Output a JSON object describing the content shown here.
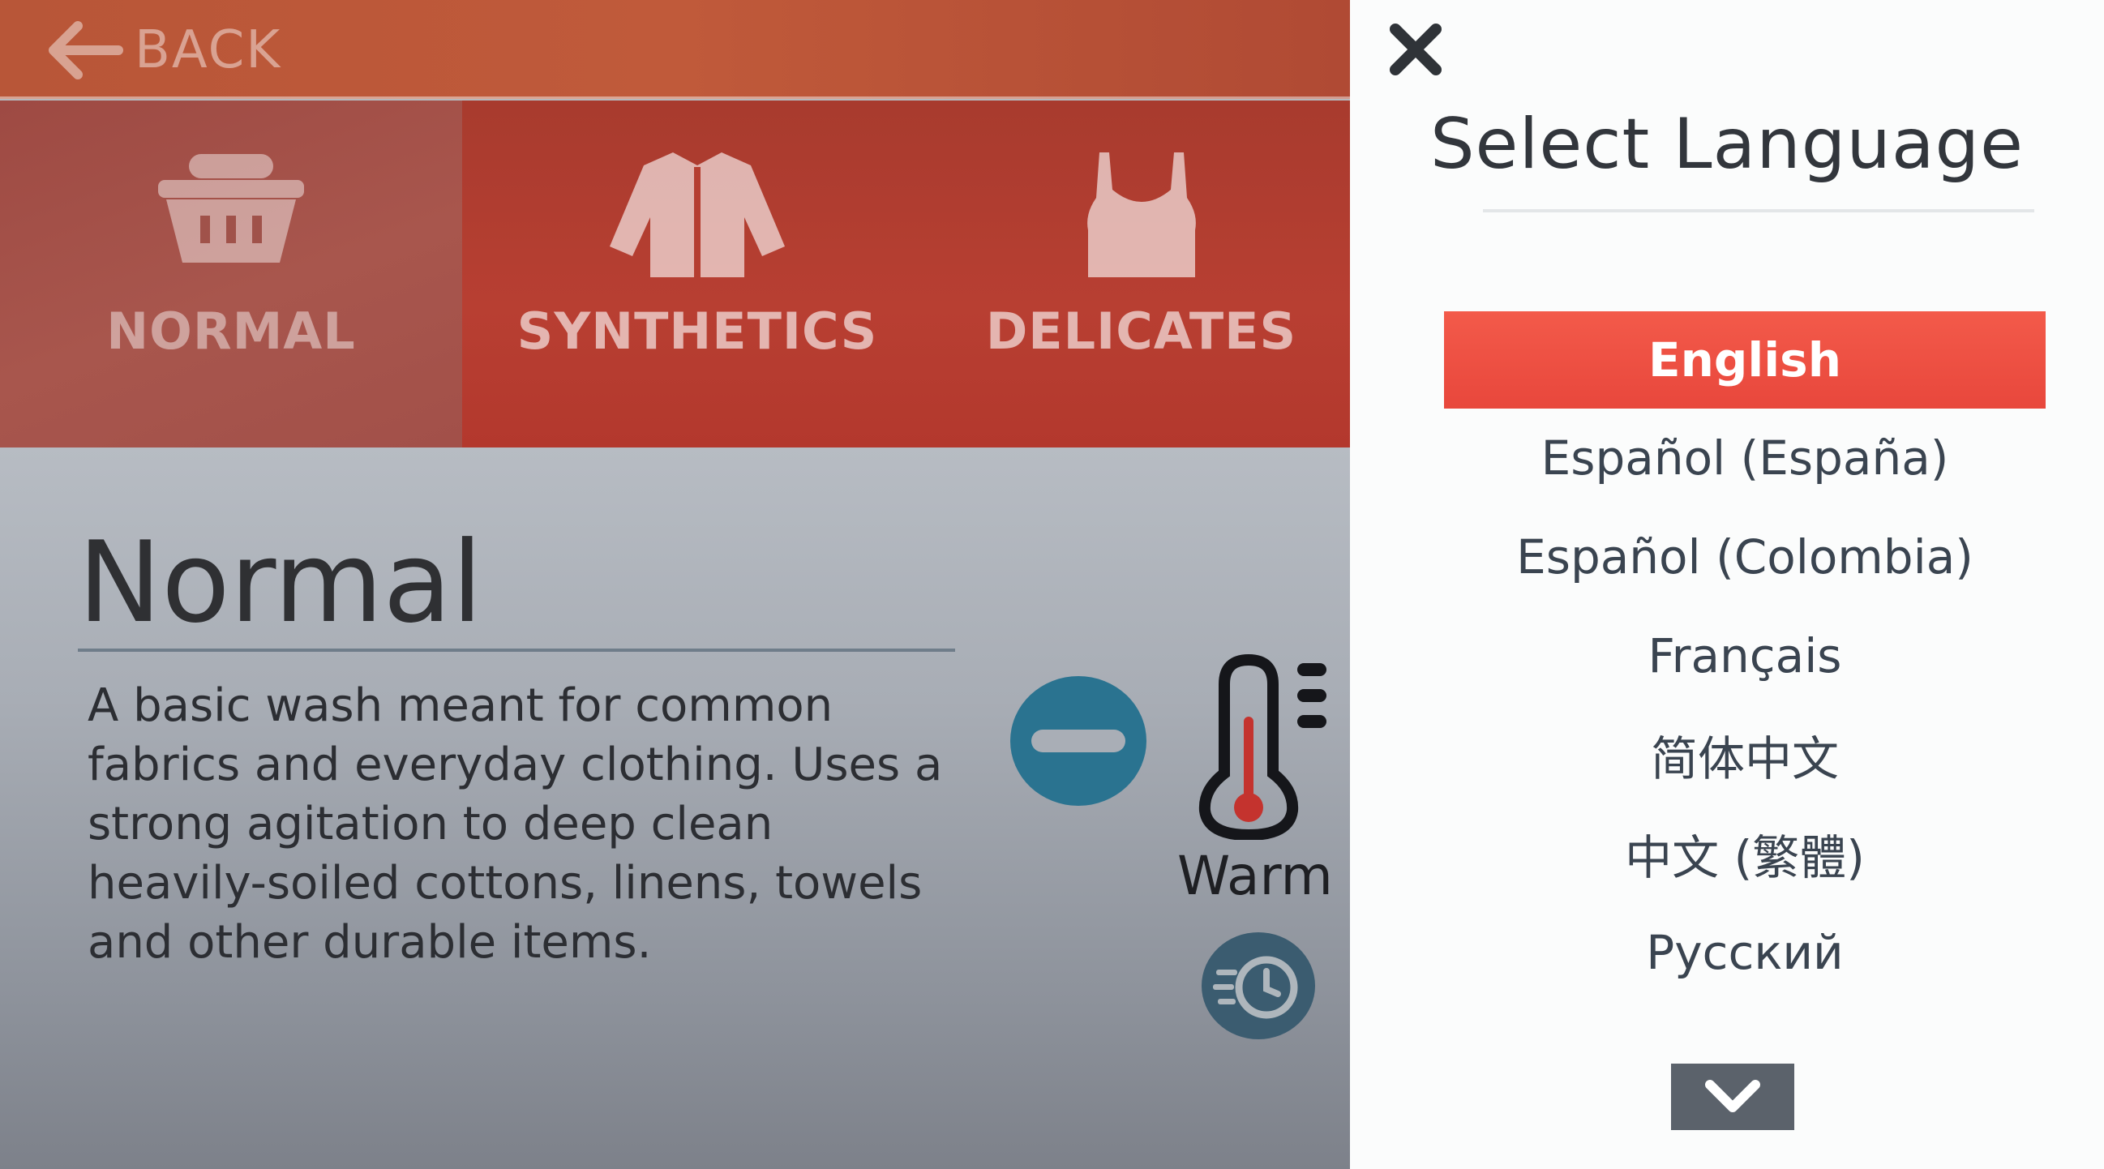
{
  "app": {
    "back_label": "BACK",
    "tabs": [
      {
        "label": "NORMAL",
        "icon": "basket-icon",
        "selected": true
      },
      {
        "label": "SYNTHETICS",
        "icon": "jacket-icon",
        "selected": false
      },
      {
        "label": "DELICATES",
        "icon": "top-garment-icon",
        "selected": false
      }
    ],
    "program": {
      "title": "Normal",
      "description": "A basic wash meant for common fabrics and everyday clothing. Uses a strong agitation to deep clean heavily-soiled cottons, linens, towels and other durable items."
    },
    "temperature": {
      "label": "Warm",
      "icon": "thermometer-icon"
    },
    "controls": {
      "decrease_icon": "minus-icon",
      "timer_icon": "fast-timer-icon"
    }
  },
  "language_panel": {
    "title": "Select Language",
    "selected": "English",
    "languages": [
      "English",
      "Español (España)",
      "Español (Colombia)",
      "Français",
      "简体中文",
      "中文 (繁體)",
      "Русский"
    ],
    "close_icon": "close-icon",
    "scroll_icon": "chevron-down-icon"
  },
  "colors": {
    "accent_selected": "#e8473c",
    "header_red": "#b83f32",
    "button_teal": "#2a7390",
    "panel_bg": "#fbfcfc"
  }
}
